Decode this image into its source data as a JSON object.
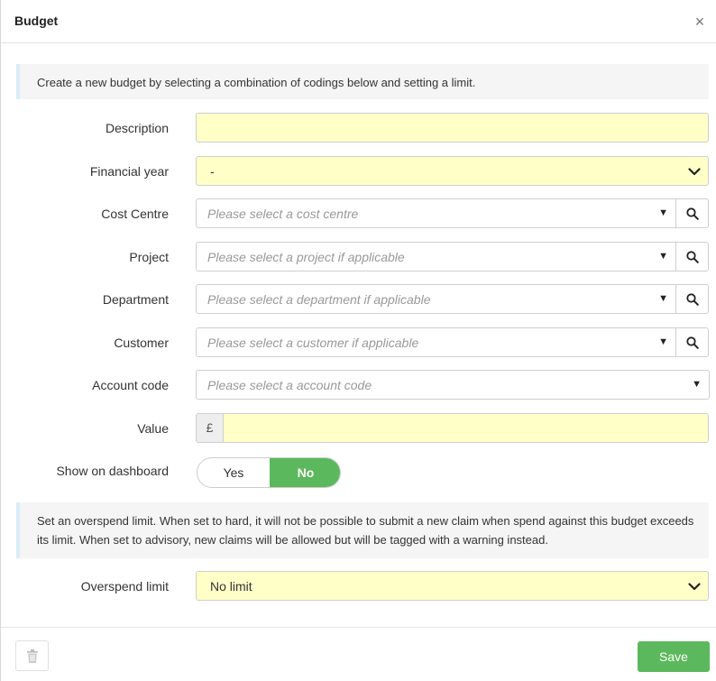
{
  "header": {
    "title": "Budget",
    "close_glyph": "×"
  },
  "intro_text": "Create a new budget by selecting a combination of codings below and setting a limit.",
  "fields": {
    "description": {
      "label": "Description",
      "value": ""
    },
    "financial_year": {
      "label": "Financial year",
      "value": "-"
    },
    "cost_centre": {
      "label": "Cost Centre",
      "placeholder": "Please select a cost centre"
    },
    "project": {
      "label": "Project",
      "placeholder": "Please select a project if applicable"
    },
    "department": {
      "label": "Department",
      "placeholder": "Please select a department if applicable"
    },
    "customer": {
      "label": "Customer",
      "placeholder": "Please select a customer if applicable"
    },
    "account_code": {
      "label": "Account code",
      "placeholder": "Please select a account code"
    },
    "value": {
      "label": "Value",
      "currency": "£",
      "value": ""
    },
    "show_on_dashboard": {
      "label": "Show on dashboard",
      "yes": "Yes",
      "no": "No",
      "selected": "No"
    }
  },
  "overspend_info": "Set an overspend limit. When set to hard, it will not be possible to submit a new claim when spend against this budget exceeds its limit. When set to advisory, new claims will be allowed but will be tagged with a warning instead.",
  "overspend_limit": {
    "label": "Overspend limit",
    "value": "No limit"
  },
  "footer": {
    "save_label": "Save"
  },
  "icons": {
    "close": "close-icon",
    "chevron": "chevron-down-icon",
    "search": "search-icon",
    "trash": "trash-icon"
  },
  "colors": {
    "field_yellow": "#ffffc8",
    "success_green": "#5cb85c",
    "info_bg": "#f5f5f5",
    "info_border": "#d9edf7"
  }
}
